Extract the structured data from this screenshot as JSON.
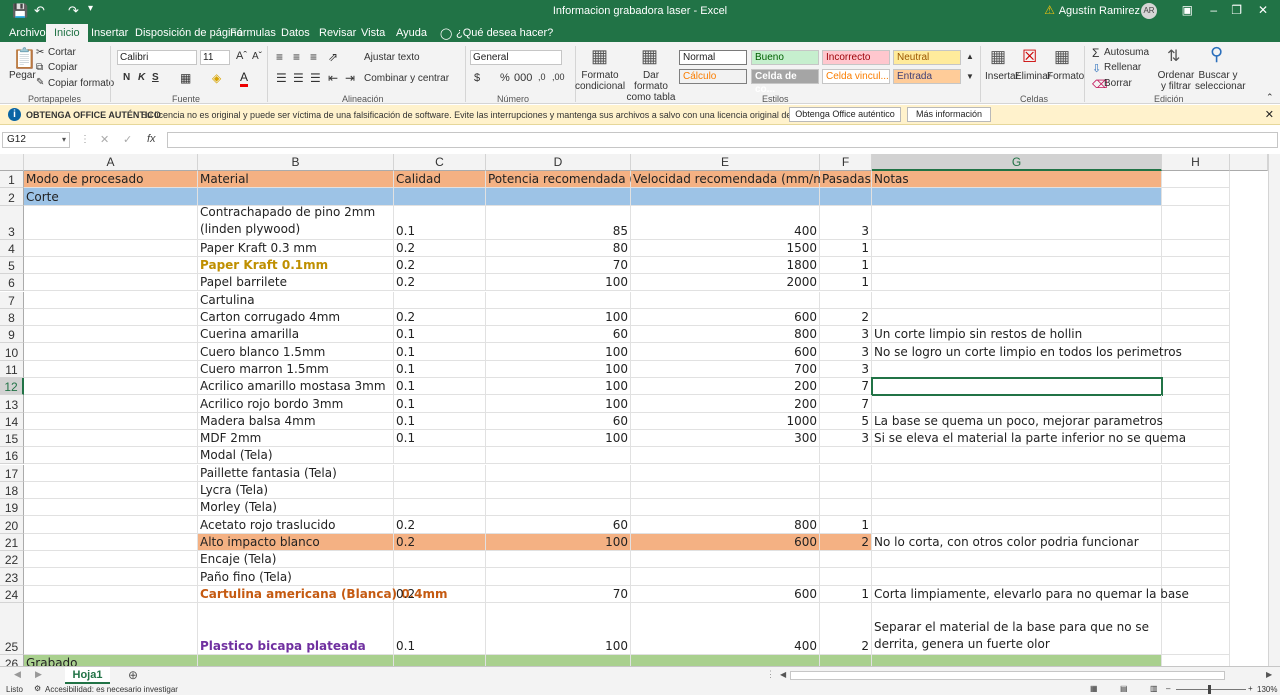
{
  "window": {
    "title": "Informacion grabadora laser  -  Excel",
    "user": "Agustín Ramirez",
    "user_initials": "AR"
  },
  "tabs": [
    "Archivo",
    "Inicio",
    "Insertar",
    "Disposición de página",
    "Fórmulas",
    "Datos",
    "Revisar",
    "Vista",
    "Ayuda",
    "¿Qué desea hacer?"
  ],
  "ribbon": {
    "clipboard": {
      "paste": "Pegar",
      "cut": "Cortar",
      "copy": "Copiar",
      "format_painter": "Copiar formato",
      "label": "Portapapeles"
    },
    "font": {
      "name": "Calibri",
      "size": "11",
      "bold": "N",
      "italic": "K",
      "underline": "S",
      "label": "Fuente"
    },
    "alignment": {
      "wrap": "Ajustar texto",
      "merge": "Combinar y centrar",
      "label": "Alineación"
    },
    "number": {
      "format": "General",
      "label": "Número"
    },
    "styles": {
      "conditional": "Formato condicional",
      "table": "Dar formato como tabla",
      "label": "Estilos",
      "items": [
        "Normal",
        "Bueno",
        "Incorrecto",
        "Neutral",
        "Cálculo",
        "Celda de co...",
        "Celda vincul...",
        "Entrada"
      ]
    },
    "cells": {
      "insert": "Insertar",
      "delete": "Eliminar",
      "format": "Formato",
      "label": "Celdas"
    },
    "editing": {
      "autosum": "Autosuma",
      "fill": "Rellenar",
      "clear": "Borrar",
      "sort": "Ordenar y filtrar",
      "find": "Buscar y seleccionar",
      "label": "Edición"
    }
  },
  "message_bar": {
    "title": "OBTENGA OFFICE AUTÉNTICO",
    "text": "Su licencia no es original y puede ser víctima de una falsificación de software. Evite las interrupciones y mantenga sus archivos a salvo con una licencia original de Office hoy mismo.",
    "button1": "Obtenga Office auténtico",
    "button2": "Más información"
  },
  "formula_bar": {
    "name_box": "G12",
    "fx": "fx",
    "value": ""
  },
  "columns": [
    "A",
    "B",
    "C",
    "D",
    "E",
    "F",
    "G",
    "H"
  ],
  "colors": {
    "accent": "#217346",
    "header_orange": "#f4b183",
    "corte_blue": "#9dc3e6",
    "grabado_green": "#a9d08e",
    "gold": "#bf8f00",
    "orange_text": "#c55a11",
    "purple": "#7030a0"
  },
  "rows": [
    {
      "n": "1",
      "a": "Modo de procesado",
      "b": "Material",
      "c": "Calidad",
      "d": "Potencia recomendada (%)",
      "e": "Velocidad recomendada (mm/min)",
      "f": "Pasadas",
      "g": "Notas"
    },
    {
      "n": "2",
      "a": "Corte",
      "b": "",
      "c": "",
      "d": "",
      "e": "",
      "f": "",
      "g": ""
    },
    {
      "n": "3",
      "a": "",
      "b": "Contrachapado de pino 2mm (linden plywood)",
      "c": "0.1",
      "d": "85",
      "e": "400",
      "f": "3",
      "g": ""
    },
    {
      "n": "4",
      "a": "",
      "b": "Paper Kraft 0.3 mm",
      "c": "0.2",
      "d": "80",
      "e": "1500",
      "f": "1",
      "g": ""
    },
    {
      "n": "5",
      "a": "",
      "b": "Paper Kraft 0.1mm",
      "c": "0.2",
      "d": "70",
      "e": "1800",
      "f": "1",
      "g": ""
    },
    {
      "n": "6",
      "a": "",
      "b": "Papel barrilete",
      "c": "0.2",
      "d": "100",
      "e": "2000",
      "f": "1",
      "g": ""
    },
    {
      "n": "7",
      "a": "",
      "b": "Cartulina",
      "c": "",
      "d": "",
      "e": "",
      "f": "",
      "g": ""
    },
    {
      "n": "8",
      "a": "",
      "b": "Carton corrugado 4mm",
      "c": "0.2",
      "d": "100",
      "e": "600",
      "f": "2",
      "g": ""
    },
    {
      "n": "9",
      "a": "",
      "b": "Cuerina amarilla",
      "c": "0.1",
      "d": "60",
      "e": "800",
      "f": "3",
      "g": "Un corte limpio sin restos de hollin"
    },
    {
      "n": "10",
      "a": "",
      "b": "Cuero blanco 1.5mm",
      "c": "0.1",
      "d": "100",
      "e": "600",
      "f": "3",
      "g": "No se logro un corte limpio en todos los perimetros"
    },
    {
      "n": "11",
      "a": "",
      "b": "Cuero marron 1.5mm",
      "c": "0.1",
      "d": "100",
      "e": "700",
      "f": "3",
      "g": ""
    },
    {
      "n": "12",
      "a": "",
      "b": "Acrilico amarillo mostasa 3mm",
      "c": "0.1",
      "d": "100",
      "e": "200",
      "f": "7",
      "g": ""
    },
    {
      "n": "13",
      "a": "",
      "b": "Acrilico rojo bordo 3mm",
      "c": "0.1",
      "d": "100",
      "e": "200",
      "f": "7",
      "g": ""
    },
    {
      "n": "14",
      "a": "",
      "b": "Madera balsa 4mm",
      "c": "0.1",
      "d": "60",
      "e": "1000",
      "f": "5",
      "g": "La base se quema un poco, mejorar parametros"
    },
    {
      "n": "15",
      "a": "",
      "b": "MDF 2mm",
      "c": "0.1",
      "d": "100",
      "e": "300",
      "f": "3",
      "g": "Si se eleva el material la parte inferior no se quema"
    },
    {
      "n": "16",
      "a": "",
      "b": "Modal (Tela)",
      "c": "",
      "d": "",
      "e": "",
      "f": "",
      "g": ""
    },
    {
      "n": "17",
      "a": "",
      "b": "Paillette fantasia (Tela)",
      "c": "",
      "d": "",
      "e": "",
      "f": "",
      "g": ""
    },
    {
      "n": "18",
      "a": "",
      "b": "Lycra (Tela)",
      "c": "",
      "d": "",
      "e": "",
      "f": "",
      "g": ""
    },
    {
      "n": "19",
      "a": "",
      "b": "Morley (Tela)",
      "c": "",
      "d": "",
      "e": "",
      "f": "",
      "g": ""
    },
    {
      "n": "20",
      "a": "",
      "b": "Acetato rojo traslucido",
      "c": "0.2",
      "d": "60",
      "e": "800",
      "f": "1",
      "g": ""
    },
    {
      "n": "21",
      "a": "",
      "b": "Alto impacto blanco",
      "c": "0.2",
      "d": "100",
      "e": "600",
      "f": "2",
      "g": "No lo corta, con otros color podria funcionar"
    },
    {
      "n": "22",
      "a": "",
      "b": "Encaje (Tela)",
      "c": "",
      "d": "",
      "e": "",
      "f": "",
      "g": ""
    },
    {
      "n": "23",
      "a": "",
      "b": "Paño fino (Tela)",
      "c": "",
      "d": "",
      "e": "",
      "f": "",
      "g": ""
    },
    {
      "n": "24",
      "a": "",
      "b": "Cartulina americana (Blanca) 0.4mm",
      "c": "0.2",
      "d": "70",
      "e": "600",
      "f": "1",
      "g": "Corta limpiamente, elevarlo para no quemar la base"
    },
    {
      "n": "25",
      "a": "",
      "b": "Plastico bicapa plateada",
      "c": "0.1",
      "d": "100",
      "e": "400",
      "f": "2",
      "g": "Separar el material de la base para que no se derrita, genera un fuerte olor"
    },
    {
      "n": "26",
      "a": "Grabado",
      "b": "",
      "c": "",
      "d": "",
      "e": "",
      "f": "",
      "g": ""
    }
  ],
  "sheet_tabs": [
    "Hoja1"
  ],
  "status": {
    "ready": "Listo",
    "accessibility": "Accesibilidad: es necesario investigar",
    "zoom": "130%"
  }
}
